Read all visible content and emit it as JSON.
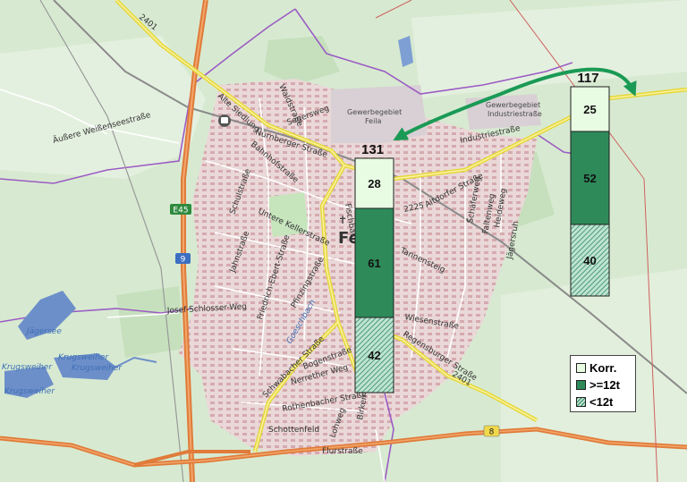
{
  "map": {
    "place_labels": {
      "town": "Fe",
      "gewerbe_left": [
        "Gewerbegebiet",
        "Feila"
      ],
      "gewerbe_right": [
        "Gewerbegebiet",
        "Industriestraße"
      ],
      "jaegersee": "Jägersee",
      "krugsweiher_1": "Krugsweiher",
      "krugsweiher_2": "Krugsweiher",
      "krugsweiher_3": "Krugsweiher",
      "krugsweiher_4": "Krugsweiher"
    },
    "street_labels": {
      "nuernberger": "Nürnberger Straße",
      "bahnhof": "Bahnhofstraße",
      "alte_siedlung": "Alte Siedlung",
      "waldstrasse": "Waldstraße",
      "segersweg": "Segersweg",
      "aeussere": "Äußere Weißenseestraße",
      "schulstrasse": "Schulstraße",
      "untere_keller": "Untere Kellerstraße",
      "jahnstrasse": "Jahnstraße",
      "friedrich_ebert": "Friedrich-Ebert-Straße",
      "pfinzing": "Pfinzingstraße",
      "josef_schlosser": "Josef-Schlosser-Weg",
      "goeschenbach": "Goeschbach",
      "schwabacher": "Schwabacher Straße",
      "bogenstrasse": "Bogenstraße",
      "nerrether": "Nerrether Weg",
      "rothenbacher": "Rothenbacher Straße",
      "schottenfeld": "Schottenfeld",
      "lonweg": "Lohweg",
      "birken": "Birken",
      "flurstrasse": "Flurstraße",
      "regensburger": "Regensburger Straße",
      "wiesenstrasse": "Wiesenstraße",
      "tannensteig": "Tannensteig",
      "altdorfer": "Altdorfer Straße",
      "industrie": "Industriestraße",
      "schaefferweg": "Schäferweg",
      "faltenweg": "Faltenweg",
      "heideweg": "Heideweg",
      "jaegersruh": "Jägersruh",
      "fischbach": "Fischbach"
    },
    "road_numbers": {
      "e45": "E45",
      "a9": "9",
      "b8": "8",
      "st2401": "2401",
      "st2225": "2225",
      "st2401b": "2401"
    }
  },
  "chart_data": {
    "type": "bar",
    "stacked": true,
    "categories": [
      "Nürnberger Straße",
      "Altdorfer Straße"
    ],
    "totals": [
      131,
      117
    ],
    "series": [
      {
        "name": "Korr.",
        "values": [
          28,
          25
        ],
        "color": "#e8fce3",
        "pattern": "solid"
      },
      {
        "name": ">=12t",
        "values": [
          61,
          52
        ],
        "color": "#2f8a5a",
        "pattern": "solid"
      },
      {
        "name": "<12t",
        "values": [
          42,
          40
        ],
        "color": "#2f8a5a",
        "pattern": "hatched"
      }
    ],
    "legend": {
      "position": "bottom-right",
      "entries": [
        "Korr.",
        ">=12t",
        "<12t"
      ]
    },
    "arrow_color": "#1a9a55"
  }
}
